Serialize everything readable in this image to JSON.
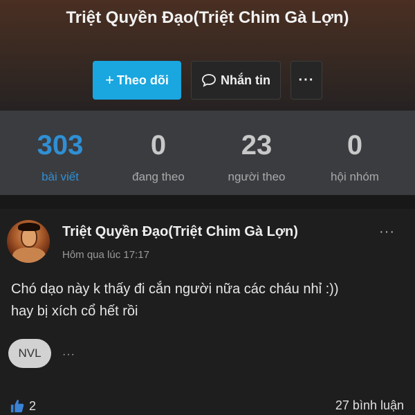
{
  "profile": {
    "name": "Triệt Quyền Đạo(Triệt Chim Gà Lợn)",
    "follow_button": "Theo dõi",
    "message_button": "Nhắn tin",
    "more_button": "···"
  },
  "stats": [
    {
      "value": "303",
      "label": "bài viết",
      "active": true
    },
    {
      "value": "0",
      "label": "đang theo",
      "active": false
    },
    {
      "value": "23",
      "label": "người theo",
      "active": false
    },
    {
      "value": "0",
      "label": "hội nhóm",
      "active": false
    }
  ],
  "post": {
    "author": "Triệt Quyền Đạo(Triệt Chim Gà Lợn)",
    "time": "Hôm qua lúc 17:17",
    "menu": "···",
    "text_line1": "Chó dạo này k thấy đi cắn người nữa các cháu nhỉ :))",
    "text_line2": "hay bị xích cổ hết rồi",
    "tag_avatar": "NVL",
    "tag_menu": "···",
    "likes": "2",
    "comments": "27 bình luận"
  },
  "colors": {
    "accent": "#1aa6df",
    "active_stat": "#2f8fd4",
    "like_icon": "#3b82d6"
  },
  "icons": {
    "follow": "plus-icon",
    "message": "chat-bubble-icon",
    "like": "thumbs-up-icon"
  }
}
